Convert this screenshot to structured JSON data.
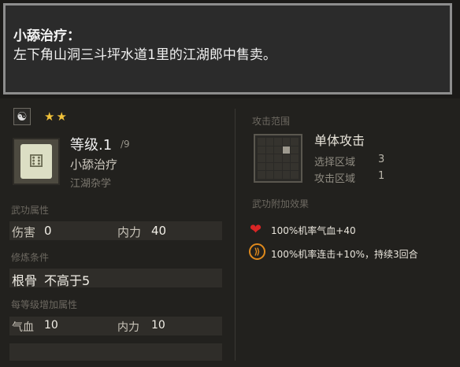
{
  "tooltip": {
    "title": "小舔治疗：",
    "description": "左下角山洞三斗坪水道1里的江湖郎中售卖。"
  },
  "skill": {
    "stars": "★★",
    "level": "等级.1",
    "level_max": "/9",
    "name": "小舔治疗",
    "category": "江湖杂学"
  },
  "attributes": {
    "section": "武功属性",
    "damage_label": "伤害",
    "damage_value": "0",
    "neili_label": "内力",
    "neili_value": "40"
  },
  "training": {
    "section": "修炼条件",
    "label": "根骨",
    "value": "不高于5"
  },
  "per_level": {
    "section": "每等级增加属性",
    "qixue_label": "气血",
    "qixue_value": "10",
    "neili_label": "内力",
    "neili_value": "10"
  },
  "attack_range": {
    "section": "攻击范围",
    "title": "单体攻击",
    "select_label": "选择区域",
    "select_value": "3",
    "attack_label": "攻击区域",
    "attack_value": "1"
  },
  "effects": {
    "section": "武功附加效果",
    "items": [
      {
        "icon": "heart-icon",
        "text": "100%机率气血+40"
      },
      {
        "icon": "combo-icon",
        "text": "100%机率连击+10%，持续3回合"
      }
    ]
  },
  "colors": {
    "star": "#f1c23a",
    "heart": "#d92525",
    "combo": "#e08a1c"
  }
}
